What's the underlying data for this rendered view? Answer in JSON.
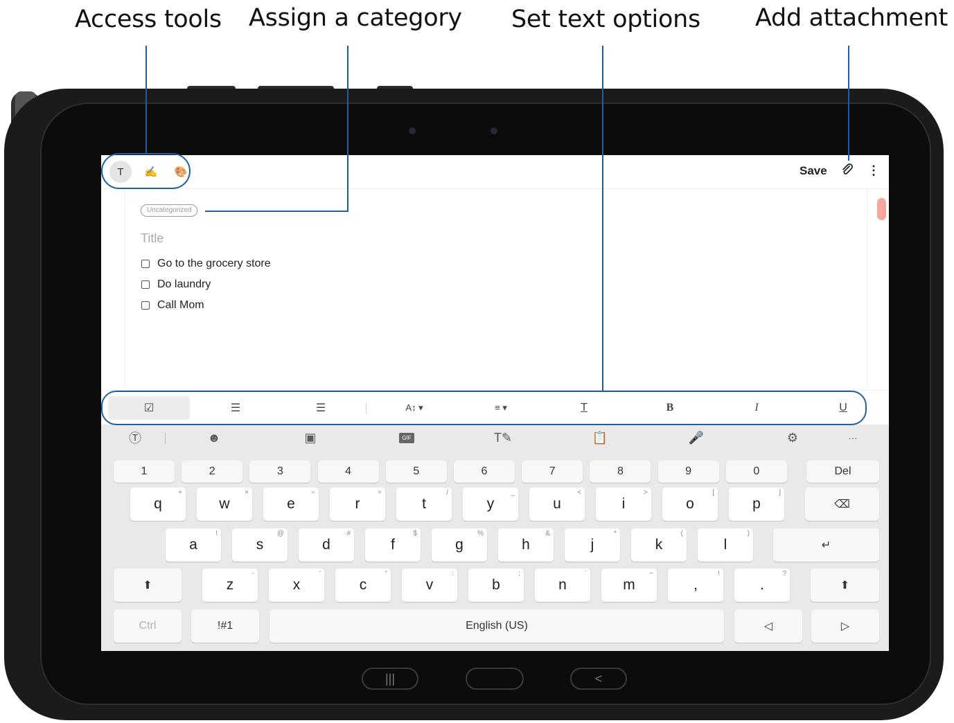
{
  "callouts": {
    "access_tools": "Access tools",
    "assign_category": "Assign a category",
    "text_options": "Set text options",
    "add_attachment": "Add attachment"
  },
  "topbar": {
    "tools": [
      {
        "icon": "text-mode-icon",
        "glyph": "T",
        "selected": true
      },
      {
        "icon": "pen-icon",
        "glyph": "✍",
        "selected": false
      },
      {
        "icon": "palette-icon",
        "glyph": "🎨",
        "selected": false
      }
    ],
    "save_label": "Save",
    "attach_glyph": "⌇",
    "more_glyph": "⋮"
  },
  "note": {
    "category_chip": "Uncategorized",
    "title_placeholder": "Title",
    "checklist": [
      "Go to the grocery store",
      "Do laundry",
      "Call Mom"
    ]
  },
  "format_bar": [
    {
      "icon": "checkbox-list-icon",
      "glyph": "☑",
      "selected": true
    },
    {
      "icon": "numbered-list-icon",
      "glyph": "☰",
      "selected": false
    },
    {
      "icon": "bulleted-list-icon",
      "glyph": "☰",
      "selected": false
    },
    {
      "icon": "font-size-icon",
      "glyph": "A↕ ▾",
      "selected": false
    },
    {
      "icon": "align-icon",
      "glyph": "≡ ▾",
      "selected": false
    },
    {
      "icon": "text-color-icon",
      "glyph": "T",
      "selected": false
    },
    {
      "icon": "bold-icon",
      "glyph": "B",
      "selected": false
    },
    {
      "icon": "italic-icon",
      "glyph": "I",
      "selected": false
    },
    {
      "icon": "underline-icon",
      "glyph": "U",
      "selected": false
    }
  ],
  "keyboard": {
    "toolbar": [
      {
        "icon": "text-recognition-icon",
        "glyph": "Ⓣ"
      },
      {
        "icon": "emoji-icon",
        "glyph": "☻"
      },
      {
        "icon": "sticker-icon",
        "glyph": "▣"
      },
      {
        "icon": "gif-icon",
        "glyph": "GIF"
      },
      {
        "icon": "handwriting-icon",
        "glyph": "T✎"
      },
      {
        "icon": "clipboard-icon",
        "glyph": "📋"
      },
      {
        "icon": "microphone-icon",
        "glyph": "🎤"
      },
      {
        "icon": "settings-gear-icon",
        "glyph": "⚙"
      },
      {
        "icon": "more-options-icon",
        "glyph": "···"
      }
    ],
    "numbers": [
      "1",
      "2",
      "3",
      "4",
      "5",
      "6",
      "7",
      "8",
      "9",
      "0"
    ],
    "del_label": "Del",
    "row_q": [
      [
        "q",
        "+"
      ],
      [
        "w",
        "×"
      ],
      [
        "e",
        "÷"
      ],
      [
        "r",
        "="
      ],
      [
        "t",
        "/"
      ],
      [
        "y",
        "_"
      ],
      [
        "u",
        "<"
      ],
      [
        "i",
        ">"
      ],
      [
        "o",
        "["
      ],
      [
        "p",
        "]"
      ]
    ],
    "row_a": [
      [
        "a",
        "!"
      ],
      [
        "s",
        "@"
      ],
      [
        "d",
        "#"
      ],
      [
        "f",
        "$"
      ],
      [
        "g",
        "%"
      ],
      [
        "h",
        "&"
      ],
      [
        "j",
        "*"
      ],
      [
        "k",
        "("
      ],
      [
        "l",
        ")"
      ]
    ],
    "row_z": [
      [
        "z",
        "-"
      ],
      [
        "x",
        "'"
      ],
      [
        "c",
        "\""
      ],
      [
        "v",
        ":"
      ],
      [
        "b",
        ";"
      ],
      [
        "n",
        "`"
      ],
      [
        "m",
        "~"
      ],
      [
        ",",
        "!"
      ],
      [
        ".",
        "?"
      ]
    ],
    "backspace_glyph": "⌫",
    "enter_glyph": "↵",
    "shift_glyph": "⬆",
    "ctrl_label": "Ctrl",
    "symbols_label": "!#1",
    "space_label": "English (US)",
    "left_arrow": "◁",
    "right_arrow": "▷"
  },
  "navbar": {
    "recents": "|||",
    "home": "",
    "back": "<"
  }
}
